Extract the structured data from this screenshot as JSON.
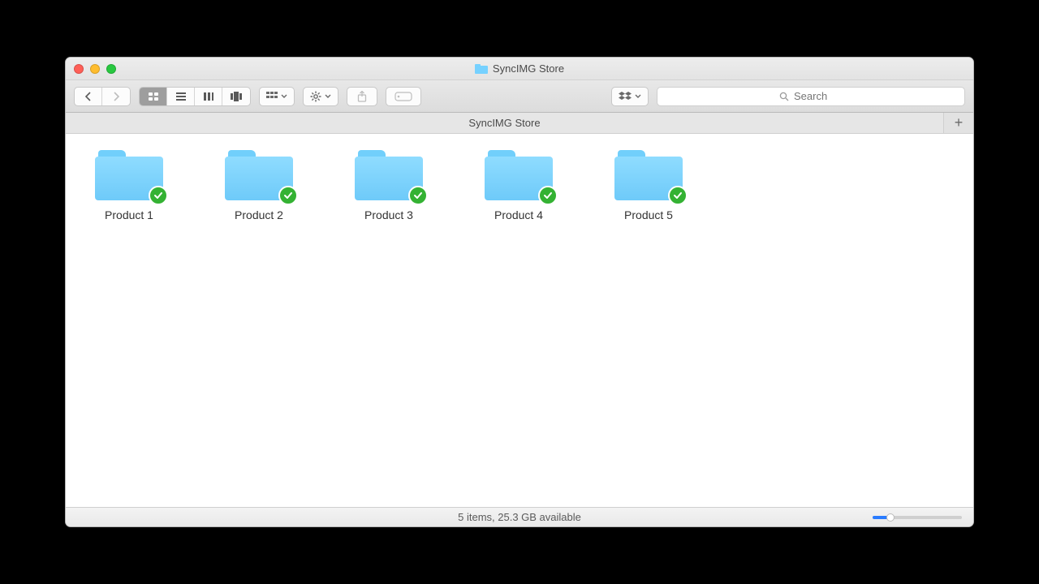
{
  "window": {
    "title": "SyncIMG Store"
  },
  "toolbar": {
    "search_placeholder": "Search"
  },
  "tabbar": {
    "tab_label": "SyncIMG Store"
  },
  "items": [
    {
      "label": "Product 1"
    },
    {
      "label": "Product 2"
    },
    {
      "label": "Product 3"
    },
    {
      "label": "Product 4"
    },
    {
      "label": "Product 5"
    }
  ],
  "status": {
    "text": "5 items, 25.3 GB available"
  }
}
